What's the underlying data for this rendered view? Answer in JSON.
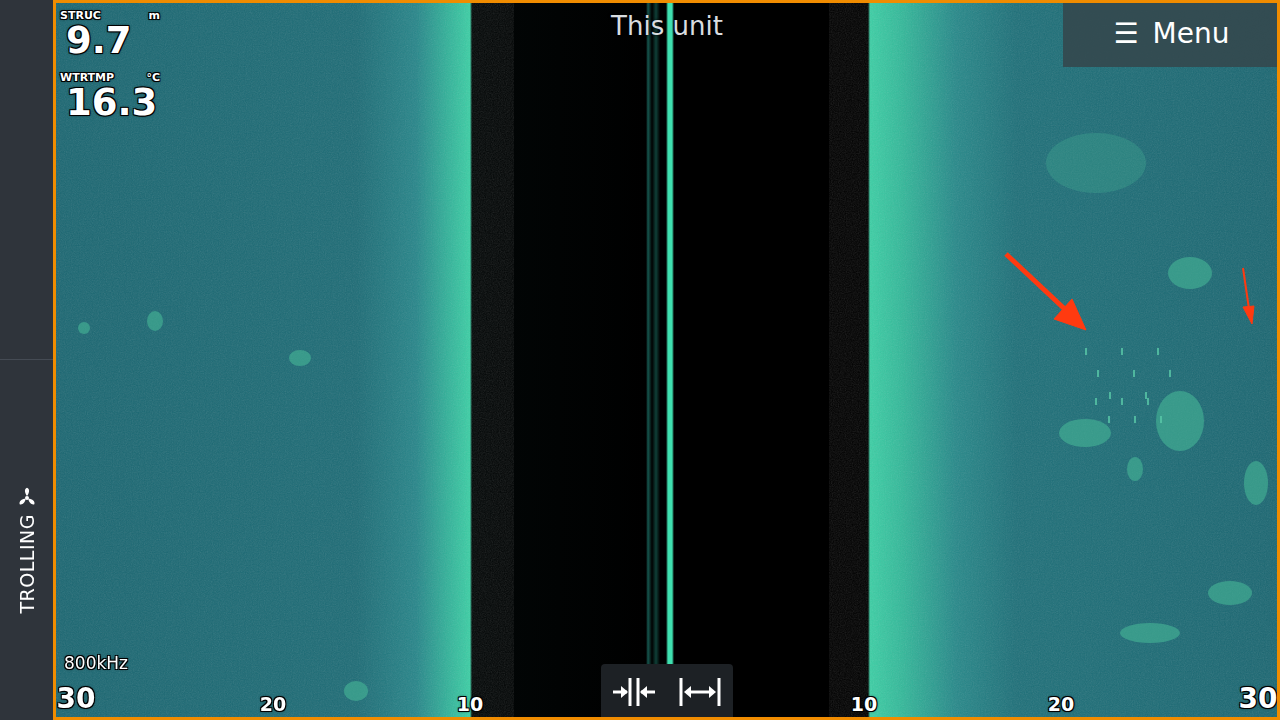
{
  "sidebar": {
    "mode": "TROLLING"
  },
  "readouts": [
    {
      "label": "STRUC",
      "unit": "m",
      "value": "9.7"
    },
    {
      "label": "WTRTMP",
      "unit": "°C",
      "value": "16.3"
    }
  ],
  "title": "This unit",
  "menu": {
    "icon": "☰",
    "label": "Menu"
  },
  "frequency": "800kHz",
  "scale": {
    "left": [
      "30",
      "20",
      "10"
    ],
    "right": [
      "10",
      "20",
      "30"
    ]
  }
}
